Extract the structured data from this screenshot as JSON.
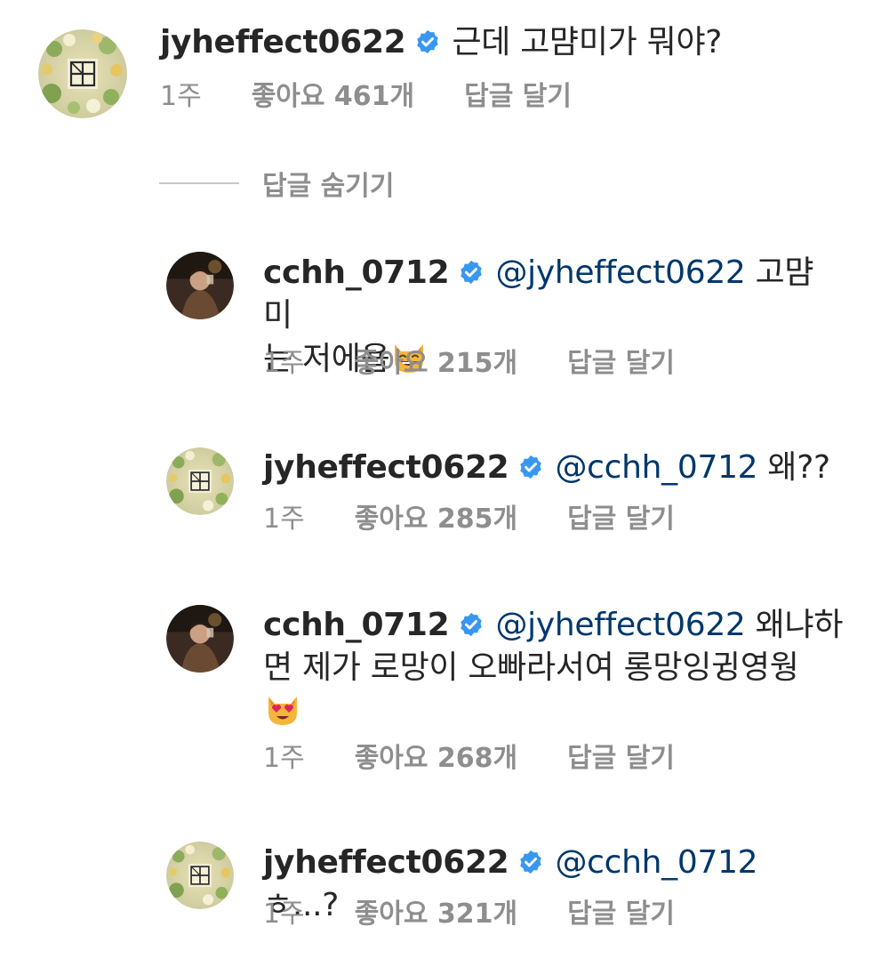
{
  "colors": {
    "text": "#262626",
    "meta": "#8e8e8e",
    "mention": "#00376b",
    "verified": "#3897f0"
  },
  "thread": {
    "hide_replies_label": "답글 숨기기",
    "parent": {
      "username": "jyheffect0622",
      "text": "근데 고먐미가 뭐야?",
      "time": "1주",
      "likes": "좋아요 461개",
      "reply": "답글 달기",
      "avatar_icon": "logo-avatar"
    },
    "replies": [
      {
        "username": "cchh_0712",
        "mention": "@jyheffect0622",
        "text_line1": " 고먐미",
        "text_line2": "는 저에욥",
        "emoji": "grinning-cat-emoji",
        "time": "1주",
        "likes": "좋아요 215개",
        "reply": "답글 달기",
        "avatar_icon": "photo-avatar"
      },
      {
        "username": "jyheffect0622",
        "mention": "@cchh_0712",
        "text": " 왜??",
        "time": "1주",
        "likes": "좋아요 285개",
        "reply": "답글 달기",
        "avatar_icon": "logo-avatar"
      },
      {
        "username": "cchh_0712",
        "mention": "@jyheffect0622",
        "text_line1": " 왜냐하",
        "text_line2": "면 제가 로망이 오빠라서여 롱망잉귕영웡",
        "emoji": "heart-eyes-cat-emoji",
        "time": "1주",
        "likes": "좋아요 268개",
        "reply": "답글 달기",
        "avatar_icon": "photo-avatar"
      },
      {
        "username": "jyheffect0622",
        "mention": "@cchh_0712",
        "text": " ㅎ...?",
        "time": "1주",
        "likes": "좋아요 321개",
        "reply": "답글 달기",
        "avatar_icon": "logo-avatar"
      }
    ]
  }
}
